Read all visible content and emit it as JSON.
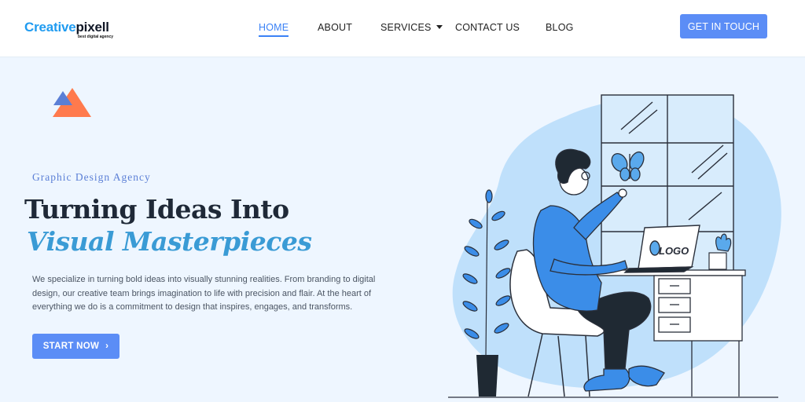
{
  "brand": {
    "name_part1": "Creative",
    "name_part2": "pixell",
    "tagline": "best digital agency"
  },
  "nav": {
    "items": [
      {
        "label": "HOME",
        "active": true
      },
      {
        "label": "ABOUT",
        "active": false
      },
      {
        "label": "SERVICES",
        "active": false,
        "has_dropdown": true
      },
      {
        "label": "CONTACT US",
        "active": false
      },
      {
        "label": "BLOG",
        "active": false
      }
    ],
    "cta_label": "GET IN TOUCH"
  },
  "hero": {
    "eyebrow": "Graphic Design Agency",
    "title_line1": "Turning Ideas Into",
    "title_line2": "Visual Masterpieces",
    "description": "We specialize in turning bold ideas into visually stunning realities. From branding to digital design, our creative team brings imagination to life with precision and flair. At the heart of everything we do is a commitment to design that inspires, engages, and transforms.",
    "button_label": "START NOW"
  },
  "illustration": {
    "screen_logo_text": "LOGO"
  },
  "colors": {
    "accent": "#5b8df6",
    "brand_blue": "#1f9bf0",
    "title_italic": "#3a9bd5",
    "hero_bg": "#eef6ff",
    "blob": "#bfe0fb",
    "triangle_orange": "#ff7a4d"
  },
  "icons": {
    "start_chevron": "chevron-right-icon",
    "services_caret": "caret-down-icon"
  }
}
